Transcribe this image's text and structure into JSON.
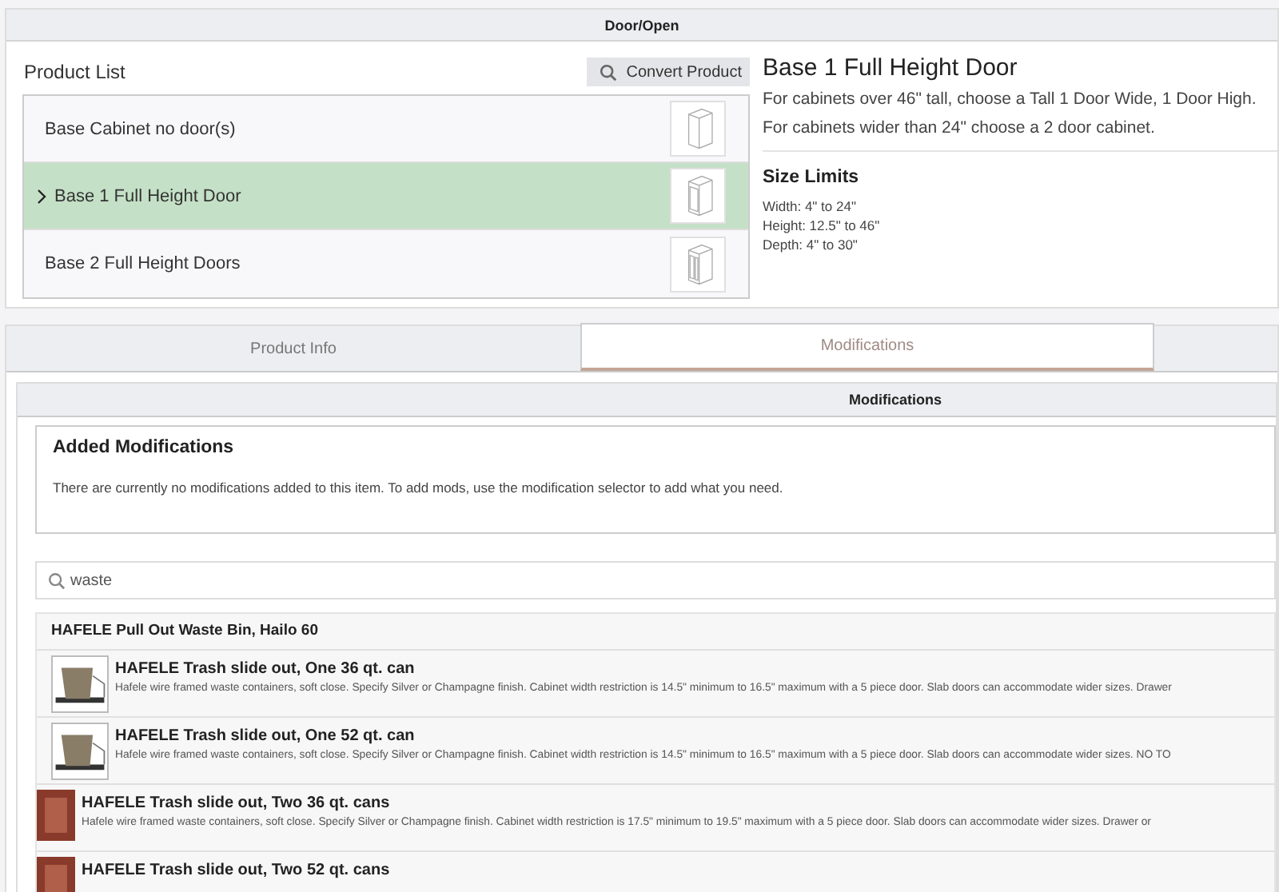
{
  "top_panel": {
    "title": "Door/Open"
  },
  "product_list": {
    "title": "Product List",
    "convert_button": "Convert Product",
    "items": [
      {
        "label": "Base Cabinet no door(s)",
        "selected": false,
        "kind": "open"
      },
      {
        "label": "Base 1 Full Height Door",
        "selected": true,
        "kind": "one-door"
      },
      {
        "label": "Base 2 Full Height Doors",
        "selected": false,
        "kind": "two-door"
      }
    ]
  },
  "detail": {
    "title": "Base 1 Full Height Door",
    "notes": [
      "For cabinets over 46\" tall, choose a Tall 1 Door Wide, 1 Door High.",
      "For cabinets wider than 24\" choose a 2 door cabinet."
    ],
    "size_title": "Size Limits",
    "sizes": [
      "Width: 4\" to 24\"",
      "Height: 12.5\" to 46\"",
      "Depth: 4\" to 30\""
    ]
  },
  "tabs": [
    {
      "label": "Product Info",
      "selected": false
    },
    {
      "label": "Modifications",
      "selected": true
    }
  ],
  "modifications": {
    "title": "Modifications",
    "added_title": "Added Modifications",
    "added_text": "There are currently no modifications added to this item. To add mods, use the modification selector to add what you need.",
    "search": {
      "value": "waste"
    },
    "group": "HAFELE Pull Out Waste Bin, Hailo 60",
    "results": [
      {
        "kind": "wire-bin",
        "title": "HAFELE Trash slide out, One 36 qt. can",
        "description": "Hafele wire framed waste containers, soft close. Specify Silver or Champagne finish. Cabinet width restriction is 14.5\" minimum to 16.5\" maximum with a 5 piece door. Slab doors can accommodate wider sizes. Drawer"
      },
      {
        "kind": "wire-bin",
        "title": "HAFELE Trash slide out, One 52 qt. can",
        "description": "Hafele wire framed waste containers, soft close. Specify Silver or Champagne finish. Cabinet width restriction is 14.5\" minimum to 16.5\" maximum with a 5 piece door. Slab doors can accommodate wider sizes. NO TO"
      },
      {
        "kind": "photo",
        "title": "HAFELE Trash slide out, Two 36 qt. cans",
        "description": "Hafele wire framed waste containers, soft close. Specify Silver or Champagne finish. Cabinet width restriction is 17.5\" minimum to 19.5\" maximum with a 5 piece door. Slab doors can accommodate wider sizes. Drawer or"
      },
      {
        "kind": "photo",
        "title": "HAFELE Trash slide out, Two 52 qt. cans"
      }
    ]
  }
}
